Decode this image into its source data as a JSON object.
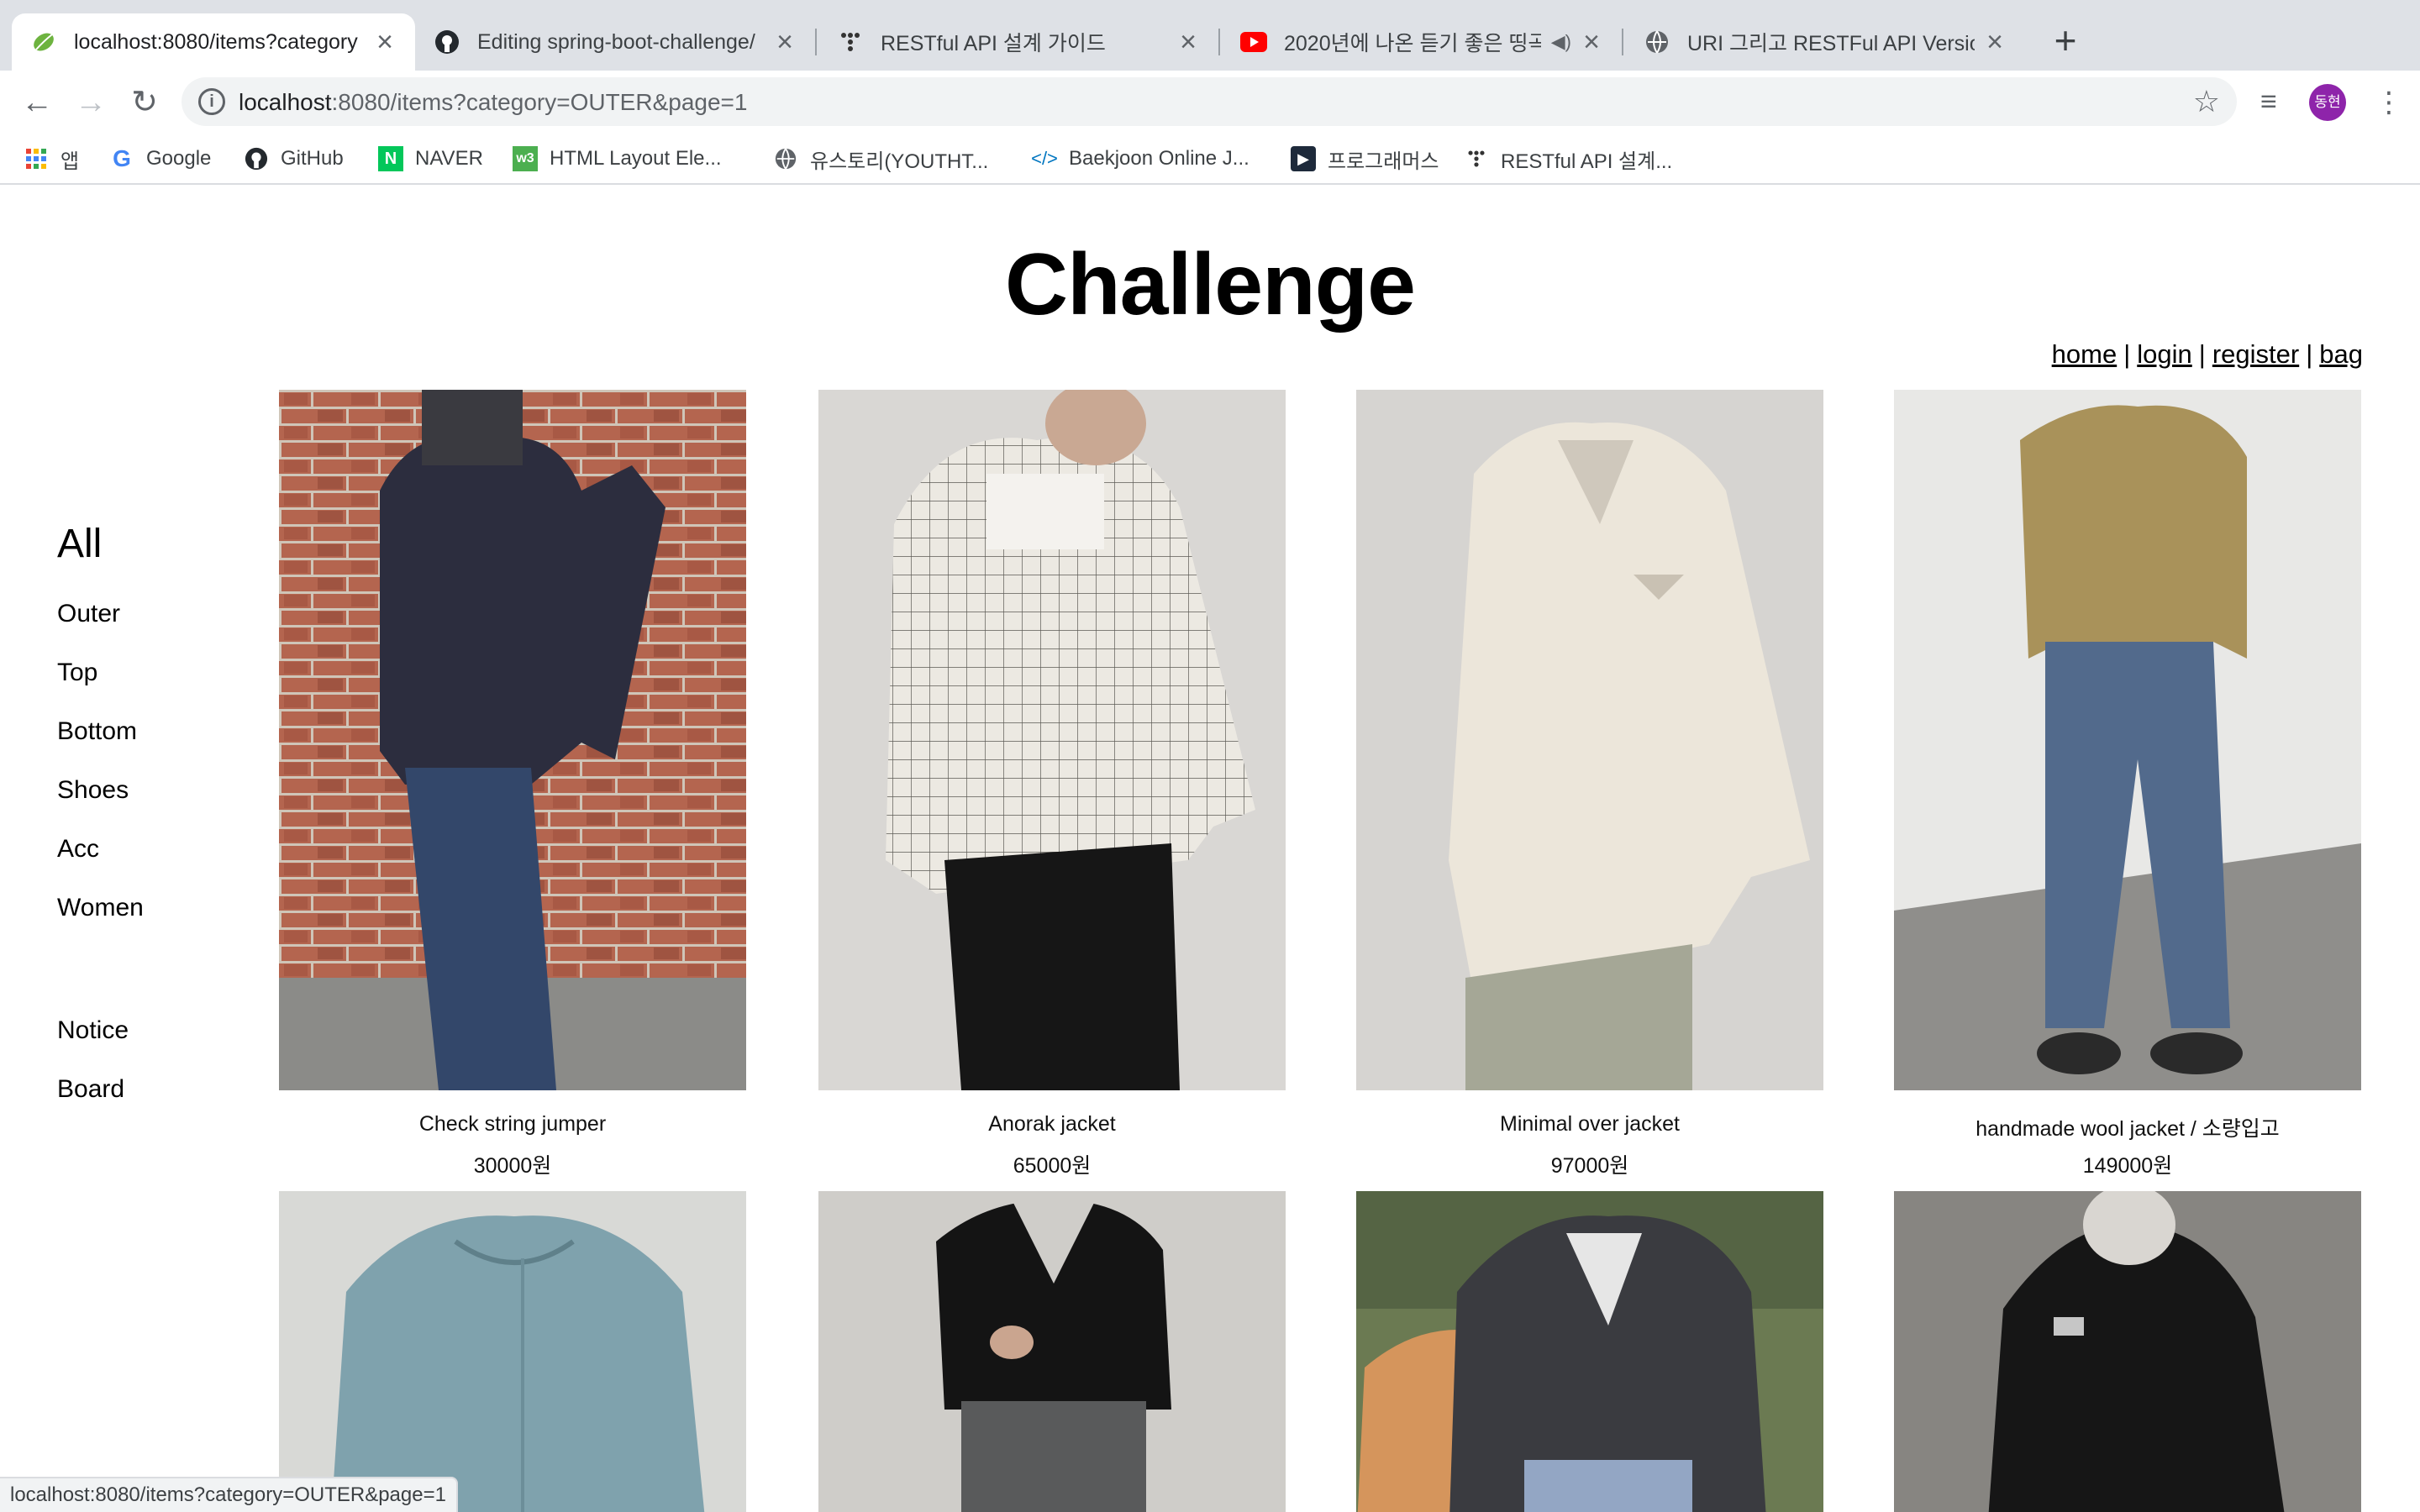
{
  "browser": {
    "tabs": [
      {
        "title": "localhost:8080/items?category",
        "icon": "spring-leaf-icon",
        "active": true
      },
      {
        "title": "Editing spring-boot-challenge/",
        "icon": "github-icon"
      },
      {
        "title": "RESTful API 설계 가이드",
        "icon": "medium-dots-icon"
      },
      {
        "title": "2020년에 나온 듣기 좋은 띵곡",
        "icon": "youtube-icon",
        "audio": "◀︎)"
      },
      {
        "title": "URI 그리고 RESTFul API Version",
        "icon": "globe-icon"
      }
    ],
    "new_tab": "+",
    "url_host": "localhost",
    "url_rest": ":8080/items?category=OUTER&page=1",
    "profile": "동현",
    "bookmarks": [
      {
        "label": "앱",
        "icon": "apps-grid-icon"
      },
      {
        "label": "Google",
        "icon": "google-icon"
      },
      {
        "label": "GitHub",
        "icon": "github-icon"
      },
      {
        "label": "NAVER",
        "icon": "naver-icon"
      },
      {
        "label": "HTML Layout Ele...",
        "icon": "w3-icon"
      },
      {
        "label": "유스토리(YOUTHT...",
        "icon": "globe-icon"
      },
      {
        "label": "Baekjoon Online J...",
        "icon": "code-icon"
      },
      {
        "label": "프로그래머스",
        "icon": "programmers-icon"
      },
      {
        "label": "RESTful API 설계...",
        "icon": "medium-dots-icon"
      }
    ],
    "status_url": "localhost:8080/items?category=OUTER&page=1"
  },
  "site": {
    "title": "Challenge",
    "nav": [
      "home",
      "login",
      "register",
      "bag"
    ],
    "categories": [
      "All",
      "Outer",
      "Top",
      "Bottom",
      "Shoes",
      "Acc",
      "Women"
    ],
    "extra_links": [
      "Notice",
      "Board"
    ]
  },
  "products": [
    {
      "name": "Check string jumper",
      "price": "30000원"
    },
    {
      "name": "Anorak jacket",
      "price": "65000원"
    },
    {
      "name": "Minimal over jacket",
      "price": "97000원"
    },
    {
      "name": "handmade wool jacket / 소량입고",
      "price": "149000원"
    },
    {
      "name": "",
      "price": ""
    },
    {
      "name": "",
      "price": ""
    },
    {
      "name": "",
      "price": ""
    },
    {
      "name": "",
      "price": ""
    }
  ]
}
